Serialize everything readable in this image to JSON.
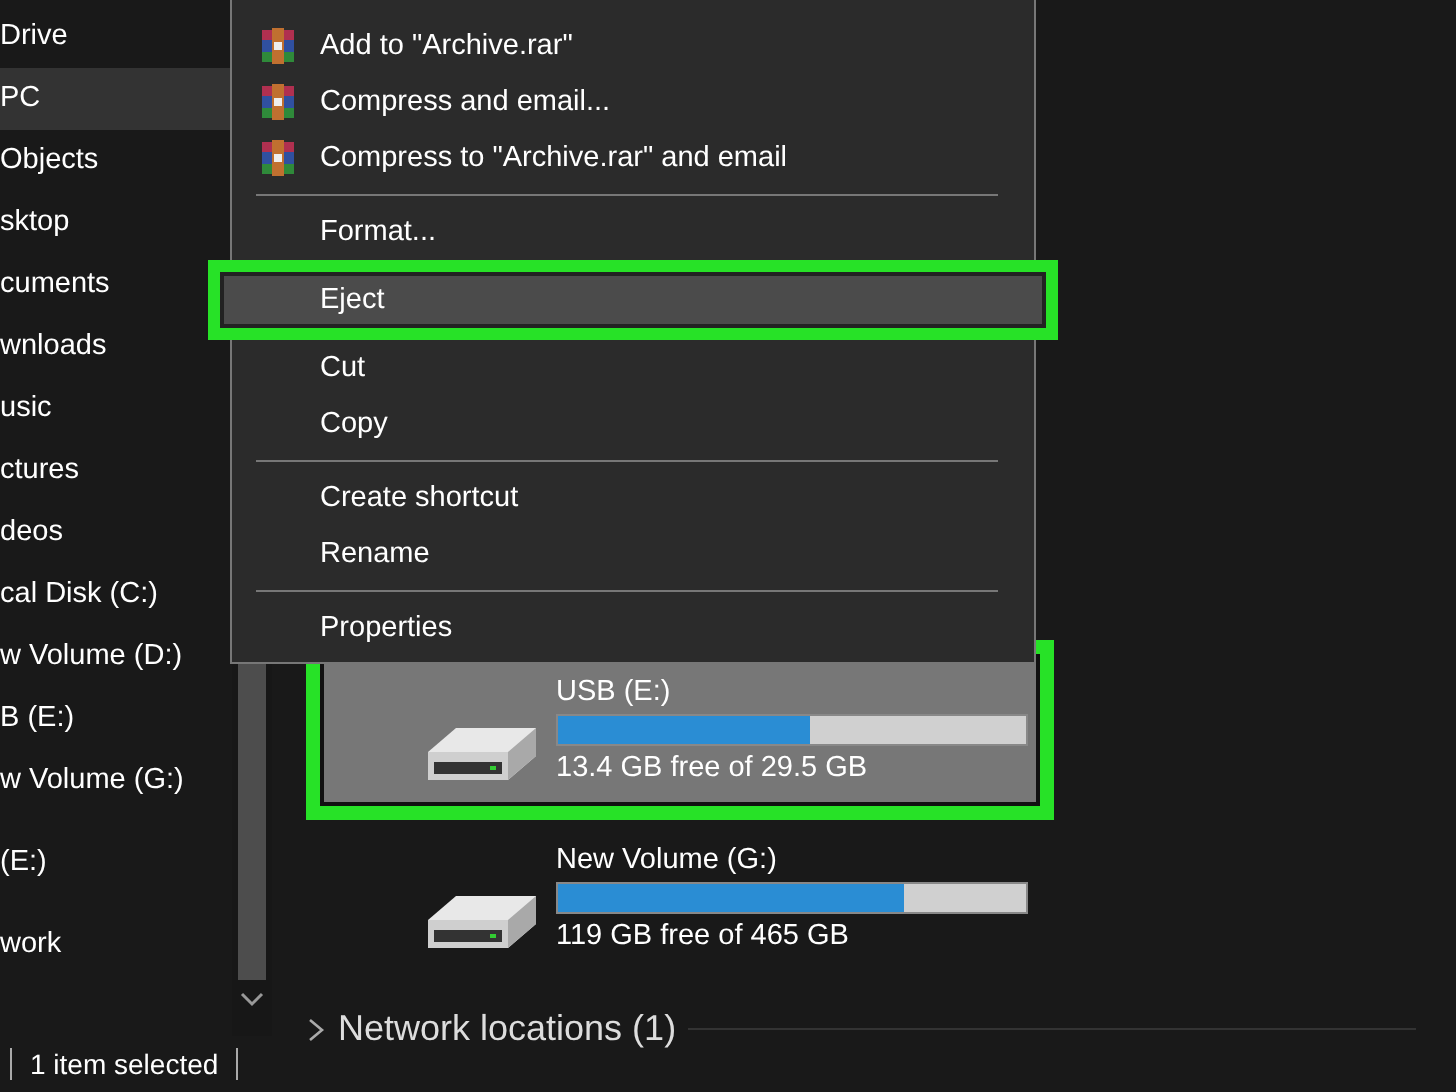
{
  "sidebar": {
    "groups": [
      {
        "items": [
          {
            "label": "Drive",
            "selected": false
          },
          {
            "label": "PC",
            "selected": true
          },
          {
            "label": "Objects",
            "selected": false
          },
          {
            "label": "sktop",
            "selected": false
          },
          {
            "label": "cuments",
            "selected": false
          },
          {
            "label": "wnloads",
            "selected": false
          },
          {
            "label": "usic",
            "selected": false
          },
          {
            "label": "ctures",
            "selected": false
          },
          {
            "label": "deos",
            "selected": false
          },
          {
            "label": "cal Disk (C:)",
            "selected": false
          },
          {
            "label": "w Volume (D:)",
            "selected": false
          },
          {
            "label": "B (E:)",
            "selected": false
          },
          {
            "label": "w Volume (G:)",
            "selected": false
          }
        ]
      },
      {
        "items": [
          {
            "label": "(E:)",
            "selected": false
          }
        ]
      },
      {
        "items": [
          {
            "label": "work",
            "selected": false
          }
        ]
      }
    ]
  },
  "drives": [
    {
      "name": "USB (E:)",
      "level": 0.54,
      "free": "13.4 GB free of 29.5 GB",
      "selected": true,
      "annotated": true
    },
    {
      "name": "New Volume (G:)",
      "level": 0.74,
      "free": "119 GB free of 465 GB",
      "selected": false,
      "annotated": false
    }
  ],
  "network_locations": {
    "label": "Network locations (1)",
    "expanded": false
  },
  "context_menu": {
    "items": [
      {
        "kind": "archive",
        "label": "Add to \"Archive.rar\"",
        "selected": false,
        "annotated": false
      },
      {
        "kind": "archive",
        "label": "Compress and email...",
        "selected": false,
        "annotated": false
      },
      {
        "kind": "archive",
        "label": "Compress to \"Archive.rar\" and email",
        "selected": false,
        "annotated": false
      },
      {
        "kind": "separator"
      },
      {
        "kind": "plain",
        "label": "Format...",
        "selected": false,
        "annotated": false
      },
      {
        "kind": "plain",
        "label": "Eject",
        "selected": true,
        "annotated": true
      },
      {
        "kind": "plain",
        "label": "Cut",
        "selected": false,
        "annotated": false
      },
      {
        "kind": "plain",
        "label": "Copy",
        "selected": false,
        "annotated": false
      },
      {
        "kind": "separator"
      },
      {
        "kind": "plain",
        "label": "Create shortcut",
        "selected": false,
        "annotated": false
      },
      {
        "kind": "plain",
        "label": "Rename",
        "selected": false,
        "annotated": false
      },
      {
        "kind": "separator"
      },
      {
        "kind": "plain",
        "label": "Properties",
        "selected": false,
        "annotated": false
      }
    ]
  },
  "status_bar": {
    "text": "1 item selected"
  }
}
